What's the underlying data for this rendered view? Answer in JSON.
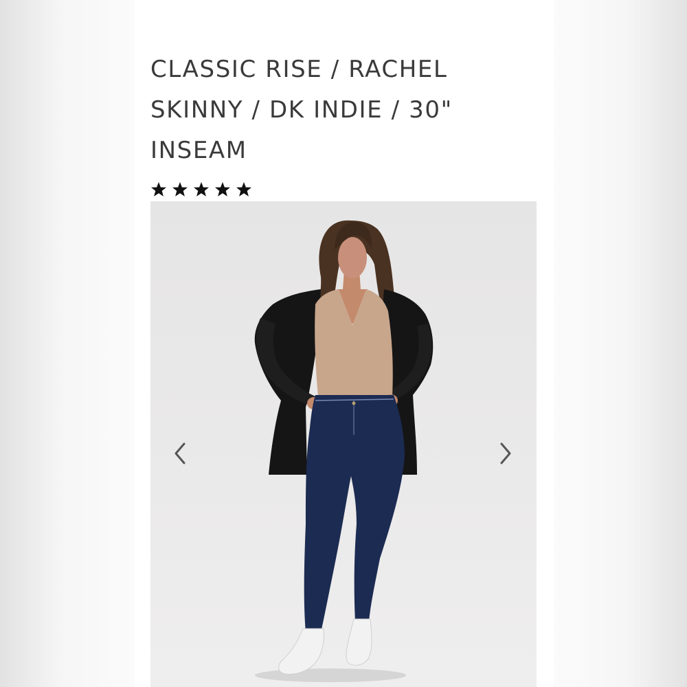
{
  "product": {
    "title": "CLASSIC RISE / RACHEL SKINNY / DK INDIE / 30\" INSEAM",
    "rating": 5,
    "rating_max": 5
  },
  "gallery": {
    "image": "model-full-body-photo",
    "prev_icon": "chevron-left-icon",
    "next_icon": "chevron-right-icon"
  },
  "colors": {
    "title_text": "#3a3a3a",
    "star": "#111111",
    "arrow": "#555555",
    "denim": "#1c2b52"
  }
}
